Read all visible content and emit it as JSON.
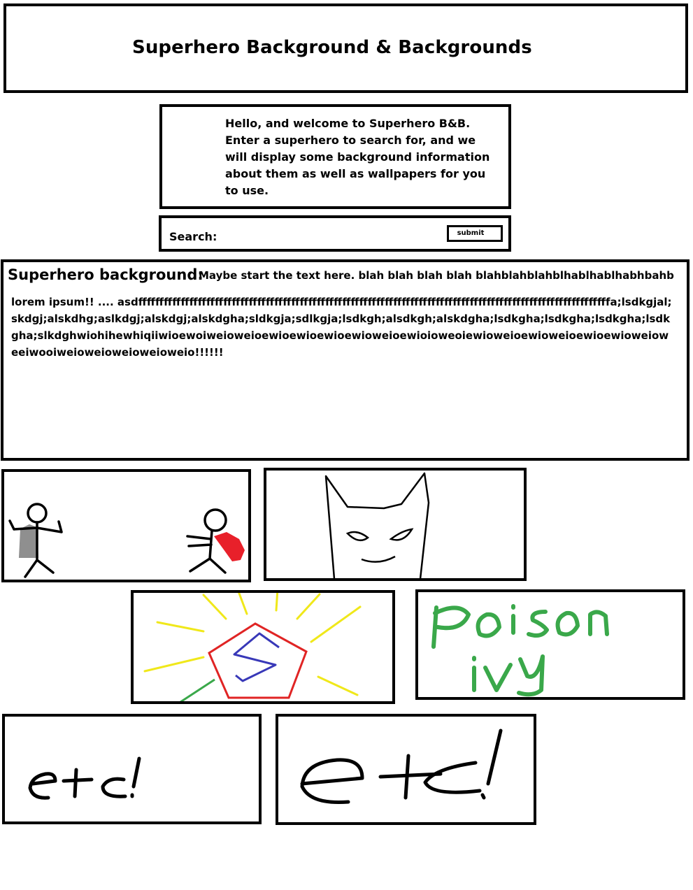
{
  "header": {
    "title": "Superhero Background & Backgrounds"
  },
  "welcome": {
    "text": "Hello, and welcome to Superhero B&B. Enter a superhero to search for, and we will display some background information about them as well as wallpapers for you to use."
  },
  "search": {
    "label": "Search:",
    "value": "",
    "submit_label": "submit"
  },
  "background": {
    "heading": "Superhero background:",
    "intro": "Maybe start the text here. blah blah blah blah blahblahblahblhablhablhabhbahb",
    "body": "lorem ipsum!! .... asdfffffffffffffffffffffffffffffffffffffffffffffffffffffffffffffffffffffffffffffffffffffffffffffffffffffffffffffffa;lsdkgjal;skdgj;alskdhg;aslkdgj;alskdgj;alskdgha;sldkgja;sdlkgja;lsdkgh;alsdkgh;alskdgha;lsdkgha;lsdkgha;lsdkgha;lsdkgha;slkdghwiohihewhiqiiwioewoiweioweioewioewioewioewioweioewioioweoiewioweioewioweioewioewioweioweeiwooiweioweioweioweioweio!!!!!!"
  },
  "gallery": {
    "tiles": [
      {
        "icon": "stick-figure-heroes-drawing"
      },
      {
        "icon": "batman-mask-drawing"
      },
      {
        "icon": "superman-logo-drawing"
      },
      {
        "icon": "poison-ivy-text-drawing",
        "text": "poison ivy"
      },
      {
        "icon": "etc-drawing",
        "text": "etc!"
      },
      {
        "icon": "etc-drawing",
        "text": "etc!"
      }
    ]
  },
  "colors": {
    "border": "#000000",
    "cape_gray": "#8f8f8f",
    "cape_red": "#e8202a",
    "logo_red": "#e02424",
    "logo_blue": "#3838b8",
    "rays_yellow": "#f0e81a",
    "ivy_green": "#3aa84a"
  }
}
